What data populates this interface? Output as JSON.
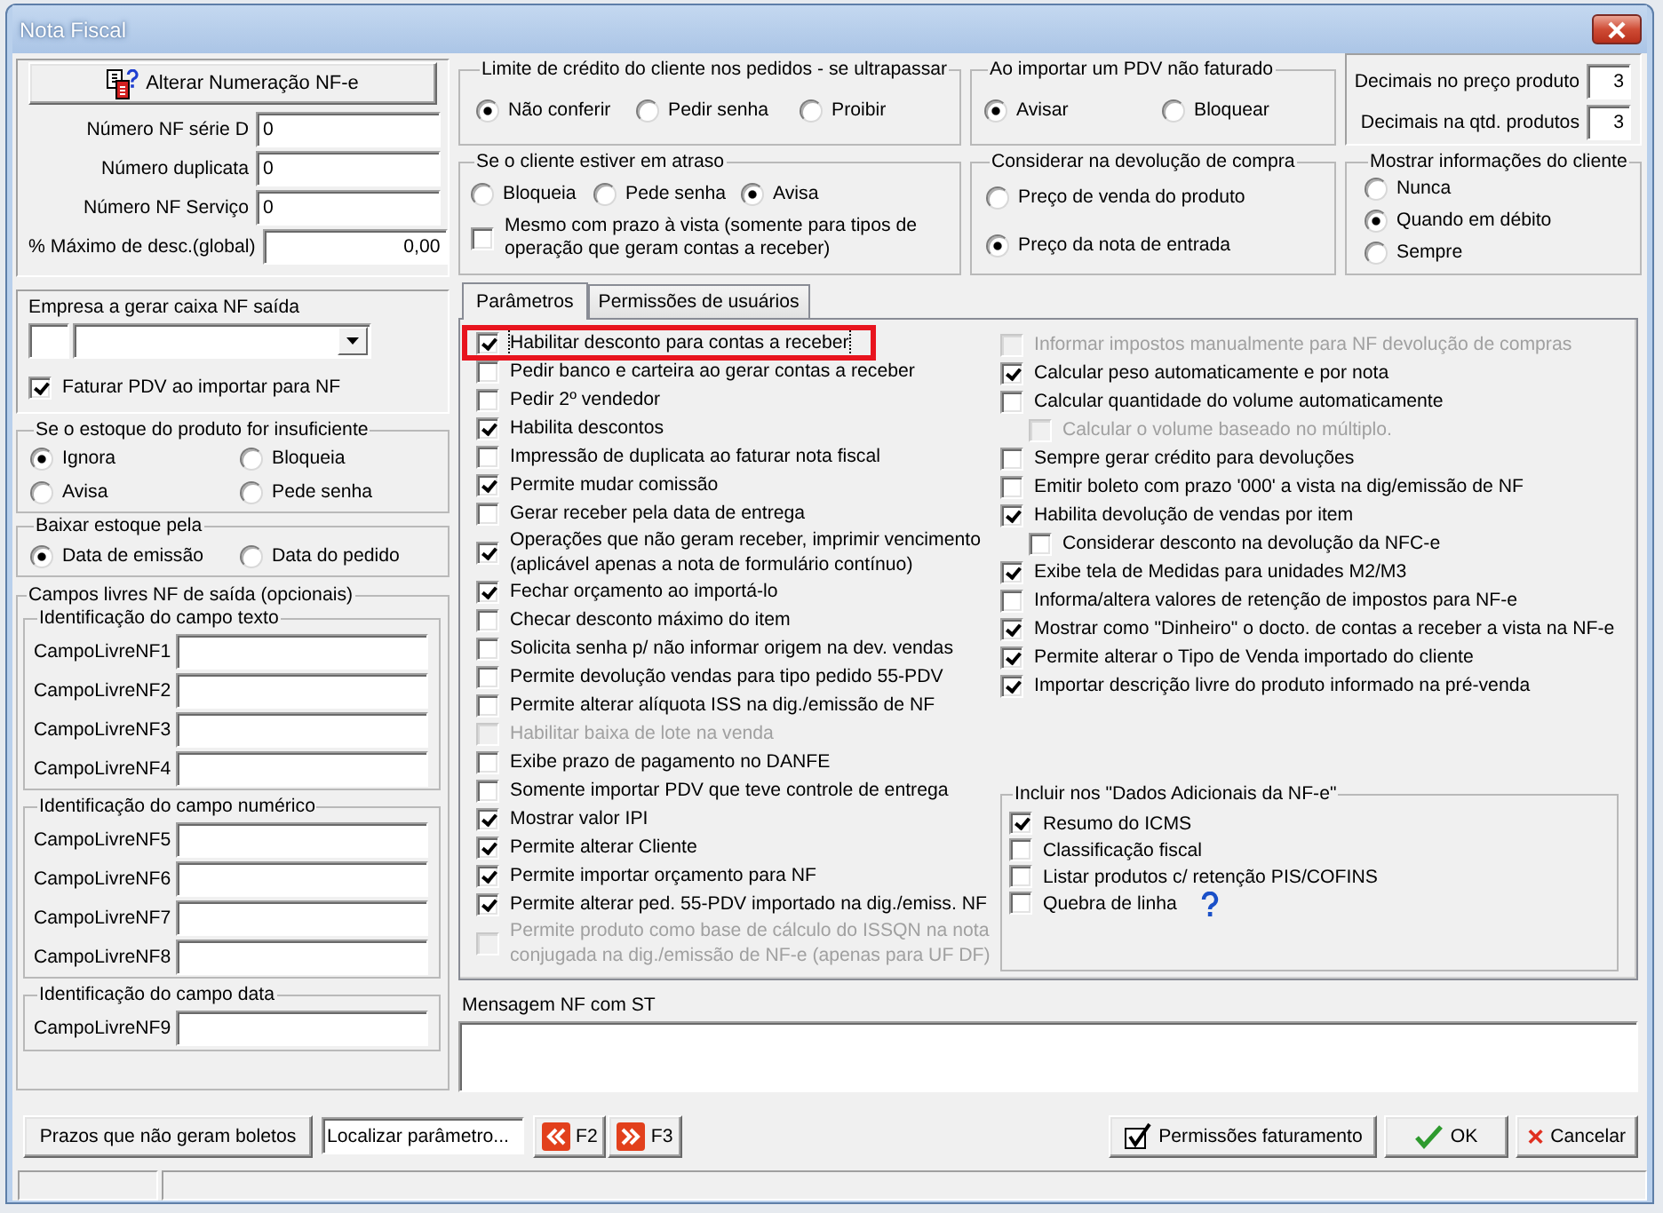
{
  "window": {
    "title": "Nota Fiscal"
  },
  "numbering": {
    "button": "Alterar Numeração NF-e",
    "fields": [
      {
        "label": "Número NF série D",
        "value": "0",
        "kind": "integer"
      },
      {
        "label": "Número duplicata",
        "value": "0",
        "kind": "integer"
      },
      {
        "label": "Número NF Serviço",
        "value": "0",
        "kind": "integer"
      },
      {
        "label": "% Máximo de desc.(global)",
        "value": "0,00",
        "kind": "decimal"
      }
    ]
  },
  "cash_company": {
    "label": "Empresa a gerar caixa NF saída",
    "checkbox": {
      "label": "Faturar PDV ao importar para NF",
      "checked": true
    }
  },
  "insufficient_stock": {
    "title": "Se o estoque do produto for insuficiente",
    "options": [
      {
        "label": "Ignora",
        "selected": true
      },
      {
        "label": "Bloqueia",
        "selected": false
      },
      {
        "label": "Avisa",
        "selected": false
      },
      {
        "label": "Pede senha",
        "selected": false
      }
    ]
  },
  "stock_deduction": {
    "title": "Baixar estoque pela",
    "options": [
      {
        "label": "Data de emissão",
        "selected": true
      },
      {
        "label": "Data do pedido",
        "selected": false
      }
    ]
  },
  "free_fields": {
    "title": "Campos livres NF de saída (opcionais)",
    "groups": [
      {
        "title": "Identificação do campo texto",
        "fields": [
          "CampoLivreNF1",
          "CampoLivreNF2",
          "CampoLivreNF3",
          "CampoLivreNF4"
        ]
      },
      {
        "title": "Identificação do campo numérico",
        "fields": [
          "CampoLivreNF5",
          "CampoLivreNF6",
          "CampoLivreNF7",
          "CampoLivreNF8"
        ]
      },
      {
        "title": "Identificação do campo data",
        "fields": [
          "CampoLivreNF9"
        ]
      }
    ]
  },
  "credit_limit": {
    "title": "Limite de crédito do cliente nos pedidos - se ultrapassar",
    "options": [
      {
        "label": "Não conferir",
        "selected": true
      },
      {
        "label": "Pedir senha",
        "selected": false
      },
      {
        "label": "Proibir",
        "selected": false
      }
    ]
  },
  "pdv_import": {
    "title": "Ao importar um PDV não faturado",
    "options": [
      {
        "label": "Avisar",
        "selected": true
      },
      {
        "label": "Bloquear",
        "selected": false
      }
    ]
  },
  "decimals": {
    "fields": [
      {
        "label": "Decimais no preço produto",
        "value": "3"
      },
      {
        "label": "Decimais na qtd. produtos",
        "value": "3"
      }
    ]
  },
  "overdue_client": {
    "title": "Se o cliente estiver em atraso",
    "options": [
      {
        "label": "Bloqueia",
        "selected": false
      },
      {
        "label": "Pede senha",
        "selected": false
      },
      {
        "label": "Avisa",
        "selected": true
      }
    ],
    "checkbox": {
      "label": "Mesmo com prazo à vista (somente para tipos de operação que geram contas a receber)",
      "checked": false
    }
  },
  "purchase_return": {
    "title": "Considerar na devolução de compra",
    "options": [
      {
        "label": "Preço de venda do produto",
        "selected": false
      },
      {
        "label": "Preço da nota de entrada",
        "selected": true
      }
    ]
  },
  "client_info": {
    "title": "Mostrar informações do cliente",
    "options": [
      {
        "label": "Nunca",
        "selected": false
      },
      {
        "label": "Quando em débito",
        "selected": true
      },
      {
        "label": "Sempre",
        "selected": false
      }
    ]
  },
  "tabs": [
    {
      "label": "Parâmetros",
      "selected": true
    },
    {
      "label": "Permissões de usuários",
      "selected": false
    }
  ],
  "parameters": {
    "column_1": [
      {
        "label": "Habilitar desconto para contas a receber",
        "checked": true,
        "disabled": false,
        "highlighted": true
      },
      {
        "label": "Pedir banco e carteira ao gerar contas a receber",
        "checked": false,
        "disabled": false,
        "highlighted": false
      },
      {
        "label": "Pedir 2º vendedor",
        "checked": false,
        "disabled": false,
        "highlighted": false
      },
      {
        "label": "Habilita descontos",
        "checked": true,
        "disabled": false,
        "highlighted": false
      },
      {
        "label": "Impressão de duplicata ao faturar nota fiscal",
        "checked": false,
        "disabled": false,
        "highlighted": false
      },
      {
        "label": "Permite mudar comissão",
        "checked": true,
        "disabled": false,
        "highlighted": false
      },
      {
        "label": "Gerar receber pela data de entrega",
        "checked": false,
        "disabled": false,
        "highlighted": false
      },
      {
        "label": "Operações que não geram receber, imprimir vencimento (aplicável apenas a nota de formulário contínuo)",
        "checked": true,
        "disabled": false,
        "highlighted": false
      },
      {
        "label": "Fechar orçamento ao importá-lo",
        "checked": true,
        "disabled": false,
        "highlighted": false
      },
      {
        "label": "Checar desconto máximo do item",
        "checked": false,
        "disabled": false,
        "highlighted": false
      },
      {
        "label": "Solicita senha p/ não informar origem na dev. vendas",
        "checked": false,
        "disabled": false,
        "highlighted": false
      },
      {
        "label": "Permite devolução vendas para tipo pedido 55-PDV",
        "checked": false,
        "disabled": false,
        "highlighted": false
      },
      {
        "label": "Permite alterar alíquota ISS na dig./emissão de NF",
        "checked": false,
        "disabled": false,
        "highlighted": false
      },
      {
        "label": "Habilitar baixa de lote na venda",
        "checked": false,
        "disabled": true,
        "highlighted": false
      },
      {
        "label": "Exibe prazo de pagamento no DANFE",
        "checked": false,
        "disabled": false,
        "highlighted": false
      },
      {
        "label": "Somente importar PDV que teve controle de entrega",
        "checked": false,
        "disabled": false,
        "highlighted": false
      },
      {
        "label": "Mostrar valor IPI",
        "checked": true,
        "disabled": false,
        "highlighted": false
      },
      {
        "label": "Permite alterar Cliente",
        "checked": true,
        "disabled": false,
        "highlighted": false
      },
      {
        "label": "Permite importar orçamento para NF",
        "checked": true,
        "disabled": false,
        "highlighted": false
      },
      {
        "label": "Permite alterar ped. 55-PDV importado na dig./emiss. NF",
        "checked": true,
        "disabled": false,
        "highlighted": false
      },
      {
        "label": "Permite produto como base de cálculo do ISSQN na nota conjugada na dig./emissão de NF-e (apenas para UF DF)",
        "checked": false,
        "disabled": true,
        "highlighted": false
      }
    ],
    "column_2": [
      {
        "label": "Informar impostos manualmente para NF devolução de compras",
        "checked": false,
        "disabled": true,
        "highlighted": false
      },
      {
        "label": "Calcular peso automaticamente e por nota",
        "checked": true,
        "disabled": false,
        "highlighted": false
      },
      {
        "label": "Calcular quantidade do volume automaticamente",
        "checked": false,
        "disabled": false,
        "highlighted": false,
        "children": [
          {
            "label": "Calcular o volume baseado no múltiplo.",
            "checked": false,
            "disabled": true,
            "highlighted": false
          }
        ]
      },
      {
        "label": "Sempre gerar crédito para devoluções",
        "checked": false,
        "disabled": false,
        "highlighted": false
      },
      {
        "label": "Emitir boleto com prazo '000' a vista na dig/emissão de NF",
        "checked": false,
        "disabled": false,
        "highlighted": false
      },
      {
        "label": "Habilita devolução de vendas por item",
        "checked": true,
        "disabled": false,
        "highlighted": false,
        "children": [
          {
            "label": "Considerar desconto na devolução da NFC-e",
            "checked": false,
            "disabled": false,
            "highlighted": false
          }
        ]
      },
      {
        "label": "Exibe tela de Medidas para unidades M2/M3",
        "checked": true,
        "disabled": false,
        "highlighted": false
      },
      {
        "label": "Informa/altera valores de retenção de impostos para NF-e",
        "checked": false,
        "disabled": false,
        "highlighted": false
      },
      {
        "label": "Mostrar como \"Dinheiro\" o docto. de contas a receber a vista na NF-e",
        "checked": true,
        "disabled": false,
        "highlighted": false
      },
      {
        "label": "Permite alterar o Tipo de Venda importado do cliente",
        "checked": true,
        "disabled": false,
        "highlighted": false
      },
      {
        "label": "Importar descrição livre do produto informado na pré-venda",
        "checked": true,
        "disabled": false,
        "highlighted": false
      }
    ],
    "additional_data": {
      "title": "Incluir nos \"Dados Adicionais da NF-e\"",
      "items": [
        {
          "label": "Resumo do ICMS",
          "checked": true
        },
        {
          "label": "Classificação fiscal",
          "checked": false
        },
        {
          "label": "Listar produtos c/ retenção PIS/COFINS",
          "checked": false
        },
        {
          "label": "Quebra de linha",
          "checked": false,
          "help": true
        }
      ]
    }
  },
  "st_message": {
    "label": "Mensagem NF com ST"
  },
  "footer": {
    "terms_button": "Prazos que não geram boletos",
    "search": {
      "placeholder": "Localizar parâmetro..."
    },
    "previous_button": "F2",
    "next_button": "F3",
    "buttons": [
      {
        "label": "Permissões faturamento",
        "kind": "permissions"
      },
      {
        "label": "OK",
        "kind": "ok"
      },
      {
        "label": "Cancelar",
        "kind": "cancel"
      }
    ]
  }
}
